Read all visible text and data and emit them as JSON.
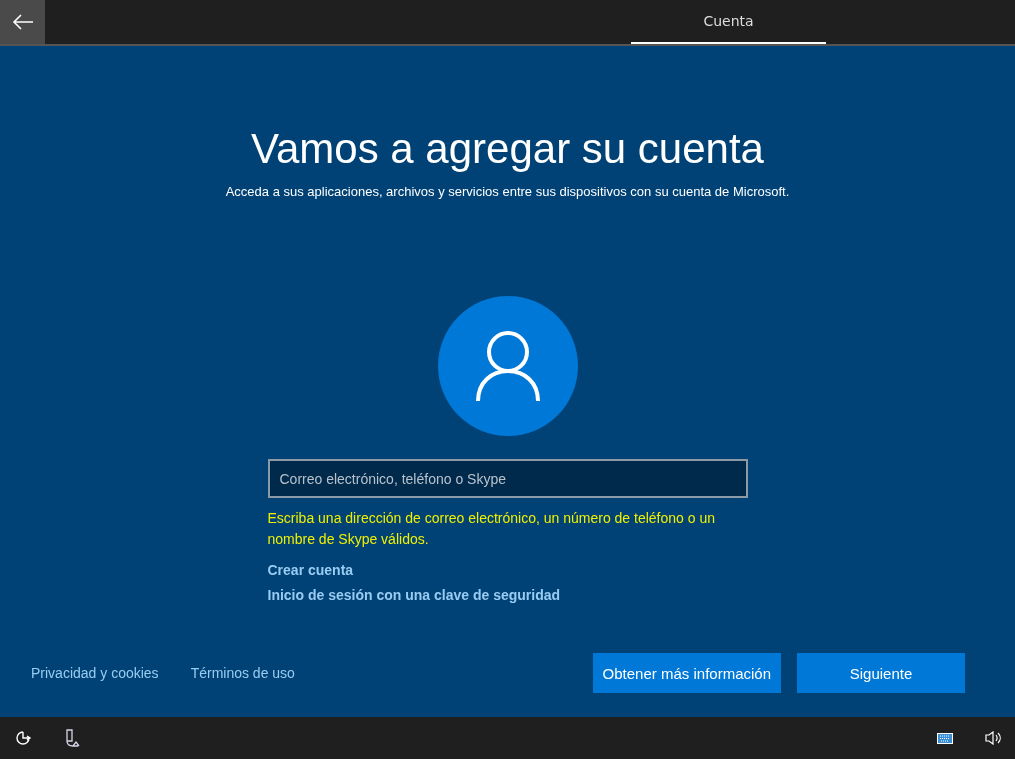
{
  "tabs": [
    {
      "label": "Cuenta",
      "selected": true
    }
  ],
  "heading": "Vamos a agregar su cuenta",
  "subheading": "Acceda a sus aplicaciones, archivos y servicios entre sus dispositivos con su cuenta de Microsoft.",
  "account_field": {
    "placeholder": "Correo electrónico, teléfono o Skype"
  },
  "error_message": "Escriba una dirección de correo electrónico, un número de teléfono o un nombre de Skype válidos.",
  "links": [
    "Crear cuenta",
    "Inicio de sesión con una clave de seguridad"
  ],
  "footer_links": [
    "Privacidad y cookies",
    "Términos de uso"
  ],
  "buttons": [
    {
      "label": "Obtener más información"
    },
    {
      "label": "Siguiente"
    }
  ]
}
